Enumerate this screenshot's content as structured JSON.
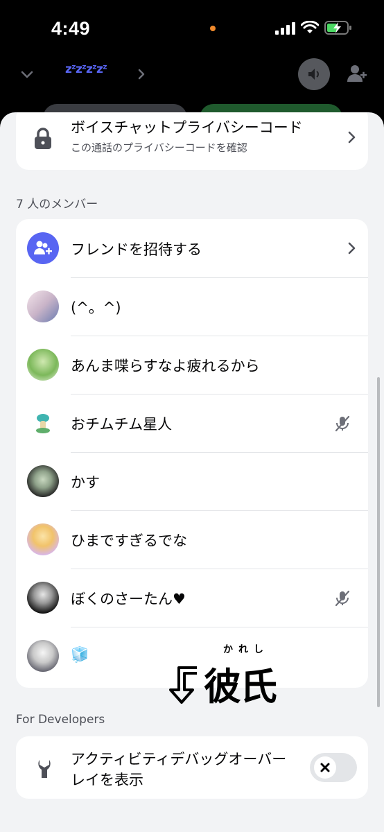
{
  "status_bar": {
    "time": "4:49"
  },
  "call_header": {
    "zzz_text": "zᶻzᶻzᶻzᶻ"
  },
  "privacy": {
    "title": "ボイスチャットプライバシーコード",
    "subtitle": "この通話のプライバシーコードを確認"
  },
  "members": {
    "header": "7 人のメンバー",
    "invite_label": "フレンドを招待する",
    "list": [
      {
        "name": "(^。^)",
        "muted": false
      },
      {
        "name": "あんま喋らすなよ疲れるから",
        "muted": false
      },
      {
        "name": "おチムチム星人",
        "muted": true
      },
      {
        "name": "かす",
        "muted": false
      },
      {
        "name": "ひまですぎるでな",
        "muted": false
      },
      {
        "name": "ぼくのさーたん♥",
        "muted": true
      },
      {
        "name": "🧊",
        "muted": false
      }
    ]
  },
  "annotation": {
    "ruby": "かれし",
    "text": "彼氏"
  },
  "developers": {
    "header": "For Developers",
    "overlay_label": "アクティビティデバッグオーバーレイを表示",
    "overlay_enabled": false
  },
  "colors": {
    "accent": "#5865f2",
    "sheet_bg": "#f2f3f5",
    "card_bg": "#ffffff"
  }
}
